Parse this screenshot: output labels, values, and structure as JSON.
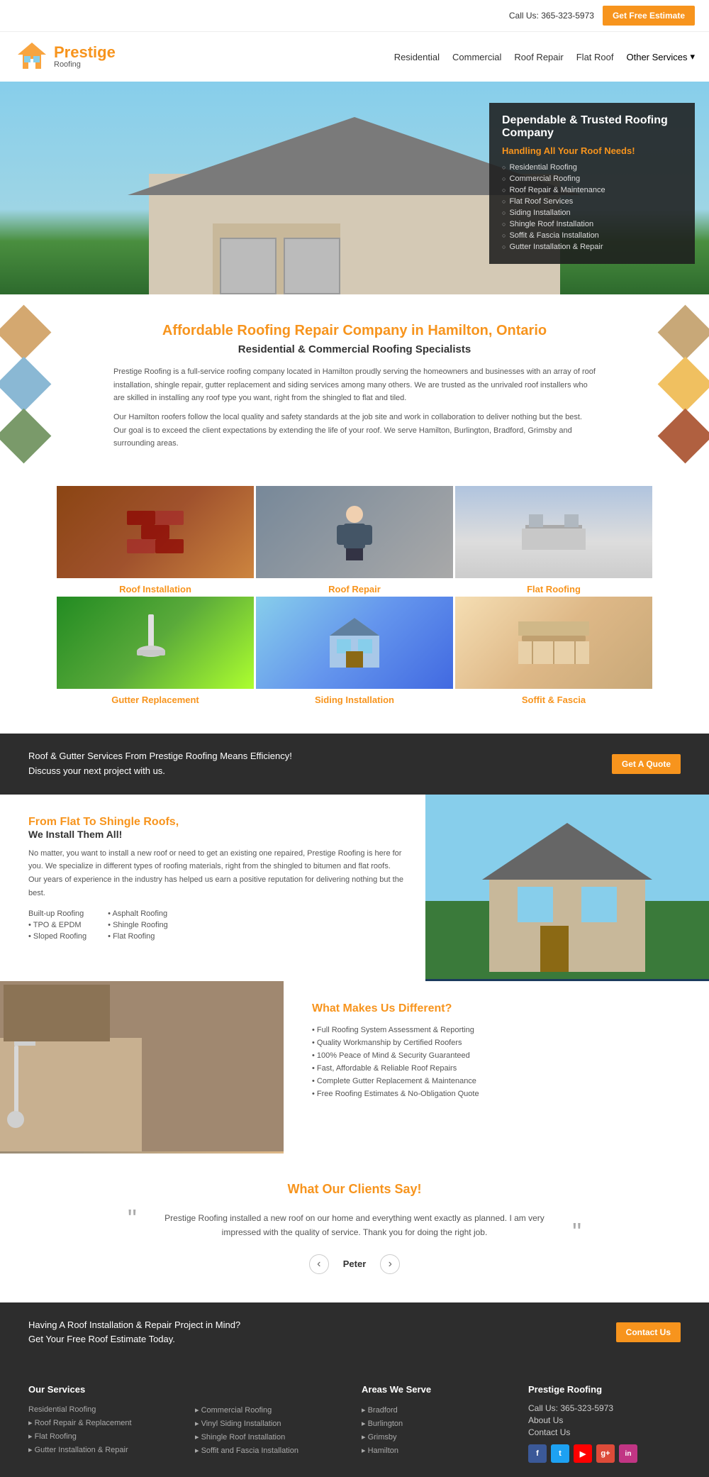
{
  "header": {
    "phone": "Call Us: 365-323-5973",
    "cta_button": "Get Free Estimate",
    "logo_text": "Prestige",
    "logo_sub": "Roofing",
    "nav": [
      "Residential",
      "Commercial",
      "Roof Repair",
      "Flat Roof",
      "Other Services"
    ]
  },
  "hero": {
    "title": "Dependable & Trusted Roofing Company",
    "subtitle": "Handling All Your Roof Needs!",
    "services": [
      "Residential Roofing",
      "Commercial Roofing",
      "Roof Repair & Maintenance",
      "Flat Roof Services",
      "Siding Installation",
      "Shingle Roof Installation",
      "Soffit & Fascia Installation",
      "Gutter Installation & Repair"
    ]
  },
  "affordable_section": {
    "heading": "Affordable Roofing Repair Company in Hamilton, Ontario",
    "subheading": "Residential & Commercial Roofing Specialists",
    "para1": "Prestige Roofing is a full-service roofing company located in Hamilton proudly serving the homeowners and businesses with an array of roof installation, shingle repair, gutter replacement and siding services among many others. We are trusted as the unrivaled roof installers who are skilled in installing any roof type you want, right from the shingled to flat and tiled.",
    "para2": "Our Hamilton roofers follow the local quality and safety standards at the job site and work in collaboration to deliver nothing but the best. Our goal is to exceed the client expectations by extending the life of your roof. We serve Hamilton, Burlington, Bradford, Grimsby and surrounding areas."
  },
  "services": [
    {
      "label": "Roof Installation",
      "img_class": "service-img-roof"
    },
    {
      "label": "Roof Repair",
      "img_class": "service-img-repair"
    },
    {
      "label": "Flat Roofing",
      "img_class": "service-img-flat"
    },
    {
      "label": "Gutter Replacement",
      "img_class": "service-img-gutter"
    },
    {
      "label": "Siding Installation",
      "img_class": "service-img-siding"
    },
    {
      "label": "Soffit & Fascia",
      "img_class": "service-img-soffit"
    }
  ],
  "cta_banner": {
    "text1": "Roof & Gutter Services From Prestige Roofing Means Efficiency!",
    "text2": "Discuss your next project with us.",
    "button": "Get A Quote"
  },
  "info_section": {
    "heading1": "From Flat To Shingle Roofs,",
    "heading2": "We Install Them All!",
    "para": "No matter, you want to install a new roof or need to get an existing one repaired, Prestige Roofing is here for you. We specialize in different types of roofing materials, right from the shingled to bitumen and flat roofs. Our years of experience in the industry has helped us earn a positive reputation for delivering nothing but the best.",
    "list_left": [
      "Built-up Roofing",
      "TPO & EPDM",
      "Sloped Roofing"
    ],
    "list_right": [
      "Asphalt Roofing",
      "Shingle Roofing",
      "Flat Roofing"
    ]
  },
  "different_section": {
    "heading": "What Makes Us Different?",
    "points": [
      "Full Roofing System Assessment & Reporting",
      "Quality Workmanship by Certified Roofers",
      "100% Peace of Mind & Security Guaranteed",
      "Fast, Affordable & Reliable Roof Repairs",
      "Complete Gutter Replacement & Maintenance",
      "Free Roofing Estimates & No-Obligation Quote"
    ]
  },
  "testimonial": {
    "heading": "What Our Clients Say!",
    "text": "Prestige Roofing installed a new roof on our home and everything went exactly as planned. I am very impressed with the quality of service. Thank you for doing the right job.",
    "author": "Peter"
  },
  "footer_cta": {
    "text1": "Having A Roof Installation & Repair Project in Mind?",
    "text2": "Get Your Free Roof Estimate Today.",
    "button": "Contact Us"
  },
  "footer": {
    "services_col1": {
      "heading": "Our Services",
      "items": [
        "Residential Roofing",
        "Roof Repair & Replacement",
        "Flat Roofing",
        "Gutter Installation & Repair"
      ]
    },
    "services_col2": {
      "items": [
        "Commercial Roofing",
        "Vinyl Siding Installation",
        "Shingle Roof Installation",
        "Soffit and Fascia Installation"
      ]
    },
    "areas": {
      "heading": "Areas We Serve",
      "items": [
        "Bradford",
        "Burlington",
        "Grimsby",
        "Hamilton"
      ]
    },
    "company": {
      "heading": "Prestige Roofing",
      "phone": "Call Us: 365-323-5973",
      "links": [
        "About Us",
        "Contact Us"
      ]
    }
  }
}
